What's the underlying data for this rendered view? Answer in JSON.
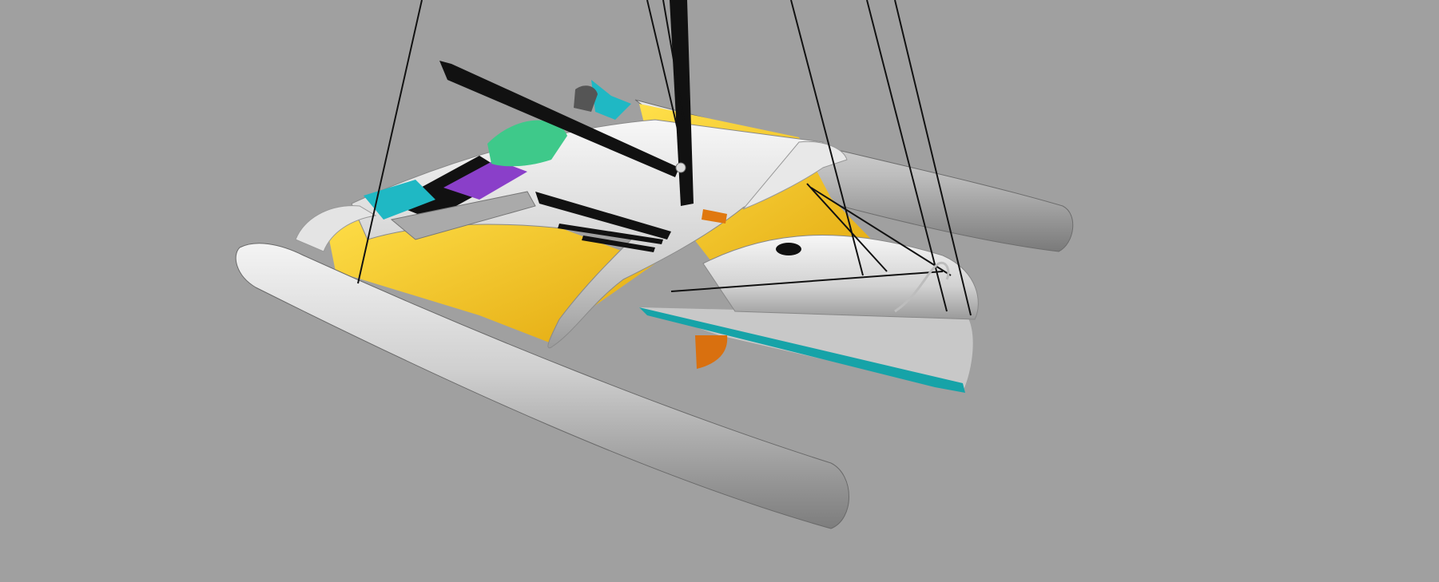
{
  "scene": {
    "subject": "trimaran-3d-render",
    "background_color": "#a0a0a0",
    "colors": {
      "hull": "#d9d9d9",
      "hull_shadow": "#8a8a8a",
      "trampoline": "#f2c21a",
      "trampoline_dark": "#c99a10",
      "cyan": "#1fb8c4",
      "teal_stripe": "#16a3a8",
      "purple": "#8a3fc9",
      "green": "#3ec98a",
      "orange": "#e0780f",
      "black": "#111111"
    }
  }
}
